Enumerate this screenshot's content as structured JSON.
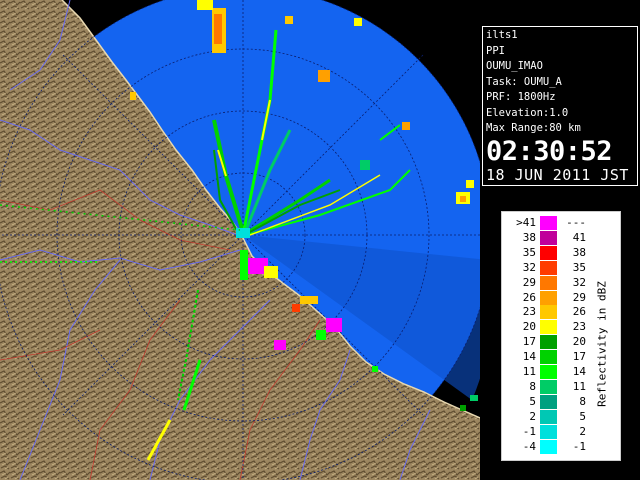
{
  "info_panel": {
    "lines": [
      "ilts1",
      "PPI",
      "OUMU_IMAO",
      "Task: OUMU_A",
      "PRF: 1800Hz",
      "Elevation:1.0",
      "Max Range:80 km"
    ],
    "time": "02:30:52",
    "date": "18 JUN 2011 JST"
  },
  "legend": {
    "unit_label": "Reflectivity in dBZ",
    "rows": [
      {
        "lo": ">41",
        "hi": "---",
        "color": "#ff00ff"
      },
      {
        "lo": "38",
        "hi": "41",
        "color": "#c0009a"
      },
      {
        "lo": "35",
        "hi": "38",
        "color": "#ff0000"
      },
      {
        "lo": "32",
        "hi": "35",
        "color": "#ff3c00"
      },
      {
        "lo": "29",
        "hi": "32",
        "color": "#ff7800"
      },
      {
        "lo": "26",
        "hi": "29",
        "color": "#ffa000"
      },
      {
        "lo": "23",
        "hi": "26",
        "color": "#ffc800"
      },
      {
        "lo": "20",
        "hi": "23",
        "color": "#ffff00"
      },
      {
        "lo": "17",
        "hi": "20",
        "color": "#00a000"
      },
      {
        "lo": "14",
        "hi": "17",
        "color": "#00d200"
      },
      {
        "lo": "11",
        "hi": "14",
        "color": "#00ff00"
      },
      {
        "lo": "8",
        "hi": "11",
        "color": "#00cc66"
      },
      {
        "lo": "5",
        "hi": "8",
        "color": "#00a080"
      },
      {
        "lo": "2",
        "hi": "5",
        "color": "#00c8b4"
      },
      {
        "lo": "-1",
        "hi": "2",
        "color": "#00e0dc"
      },
      {
        "lo": "-4",
        "hi": "-1",
        "color": "#00ffff"
      }
    ]
  },
  "map": {
    "sea_color": "#1464f0",
    "land_color": "#a08a64"
  }
}
